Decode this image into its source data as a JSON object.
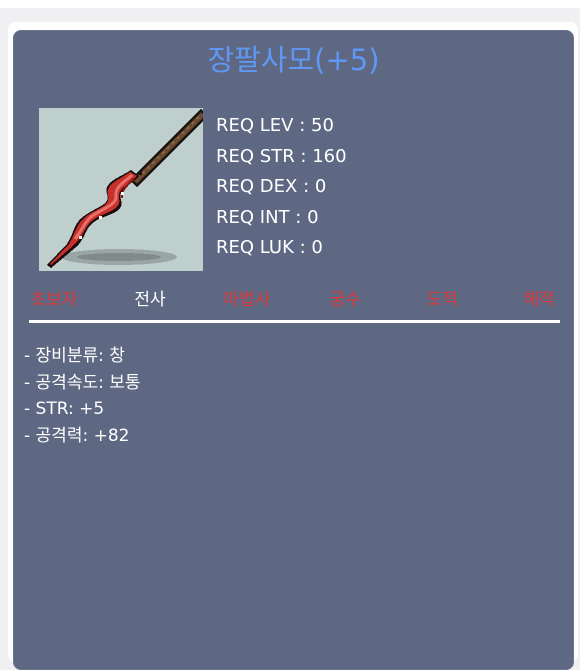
{
  "item": {
    "name": "장팔사모(+5)",
    "icon": "red-spear-icon"
  },
  "requirements": [
    {
      "label": "REQ LEV",
      "value": "50"
    },
    {
      "label": "REQ STR",
      "value": "160"
    },
    {
      "label": "REQ DEX",
      "value": "0"
    },
    {
      "label": "REQ INT",
      "value": "0"
    },
    {
      "label": "REQ LUK",
      "value": "0"
    }
  ],
  "jobs": [
    {
      "name": "초보자",
      "allowed": false
    },
    {
      "name": "전사",
      "allowed": true
    },
    {
      "name": "마법사",
      "allowed": false
    },
    {
      "name": "궁수",
      "allowed": false
    },
    {
      "name": "도적",
      "allowed": false
    },
    {
      "name": "해적",
      "allowed": false
    }
  ],
  "stats": [
    "- 장비분류: 창",
    "- 공격속도: 보통",
    "- STR: +5",
    "- 공격력: +82"
  ],
  "colors": {
    "card_bg": "#5e6883",
    "title": "#5f97f4",
    "job_allowed": "#ffffff",
    "job_disallowed": "#dc3a3a"
  }
}
